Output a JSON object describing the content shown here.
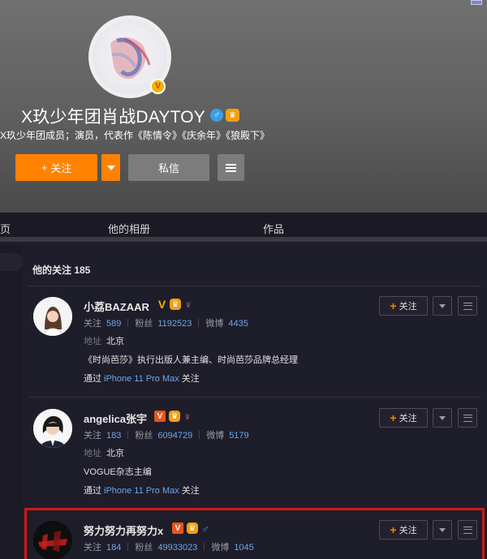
{
  "profile": {
    "name": "X玖少年团肖战DAYTOY",
    "verify_mark": "V",
    "gender_symbol": "♂",
    "crown_symbol": "♛",
    "bio": "X玖少年团成员；演员，代表作《陈情令》《庆余年》《狼殿下》",
    "follow_label": "关注",
    "plus": "+",
    "message_label": "私信"
  },
  "tabs": [
    "页",
    "他的相册",
    "作品"
  ],
  "follow_list": {
    "title": "他的关注 185",
    "labels": {
      "following": "关注",
      "fans": "粉丝",
      "weibo": "微博",
      "location": "地址",
      "via_prefix": "通过",
      "follow_button": "关注",
      "plus": "+"
    },
    "users": [
      {
        "name": "小荔BAZAAR",
        "badges": [
          "V",
          "♛",
          "♀"
        ],
        "following": "589",
        "fans": "1192523",
        "weibo": "4435",
        "location": "北京",
        "description": "《时尚芭莎》执行出版人兼主编、时尚芭莎品牌总经理",
        "device": "iPhone 11 Pro Max",
        "via_suffix": "关注"
      },
      {
        "name": "angelica张宇",
        "badges": [
          "V",
          "♛",
          "♀"
        ],
        "following": "183",
        "fans": "6094729",
        "weibo": "5179",
        "location": "北京",
        "description": "VOGUE杂志主编",
        "device": "iPhone 11 Pro Max",
        "via_suffix": "关注"
      },
      {
        "name": "努力努力再努力x",
        "badges": [
          "V",
          "♛",
          "♂"
        ],
        "following": "184",
        "fans": "49933023",
        "weibo": "1045"
      }
    ]
  },
  "colors": {
    "accent_orange": "#ff8200",
    "link_blue": "#6ea6e6",
    "highlight_red": "#d01818"
  }
}
